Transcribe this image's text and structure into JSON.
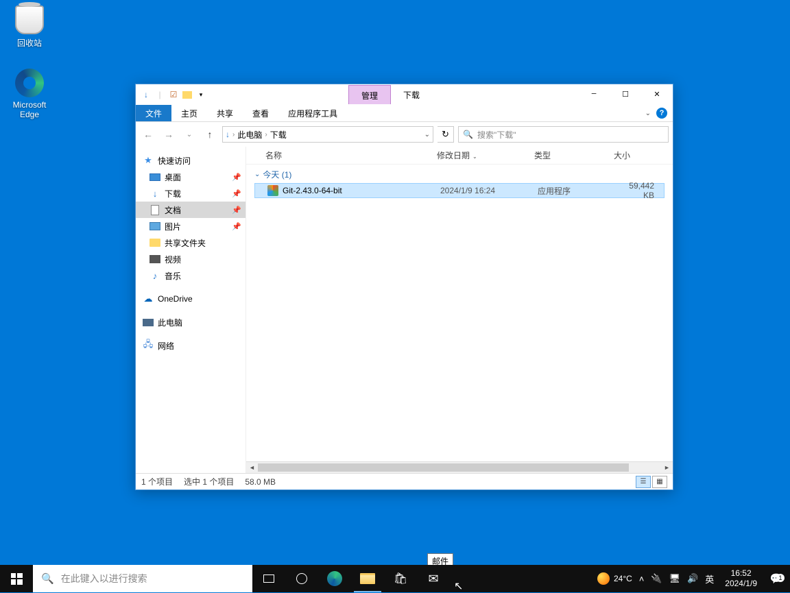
{
  "desktop": {
    "recycle_bin": "回收站",
    "edge": "Microsoft\nEdge"
  },
  "window": {
    "title_manage": "管理",
    "title_location": "下载",
    "ribbon": {
      "file": "文件",
      "home": "主页",
      "share": "共享",
      "view": "查看",
      "app_tools": "应用程序工具"
    },
    "address": {
      "root": "此电脑",
      "current": "下载"
    },
    "search_placeholder": "搜索\"下载\"",
    "nav": {
      "quick_access": "快速访问",
      "desktop": "桌面",
      "downloads": "下载",
      "documents": "文档",
      "pictures": "图片",
      "shared": "共享文件夹",
      "videos": "视频",
      "music": "音乐",
      "onedrive": "OneDrive",
      "this_pc": "此电脑",
      "network": "网络"
    },
    "columns": {
      "name": "名称",
      "date": "修改日期",
      "type": "类型",
      "size": "大小"
    },
    "group_today": "今天 (1)",
    "files": [
      {
        "name": "Git-2.43.0-64-bit",
        "date": "2024/1/9 16:24",
        "type": "应用程序",
        "size": "59,442 KB"
      }
    ],
    "status": {
      "items": "1 个项目",
      "selected": "选中 1 个项目",
      "size": "58.0 MB"
    }
  },
  "tooltip": "邮件",
  "taskbar": {
    "search_placeholder": "在此键入以进行搜索",
    "weather_temp": "24°C",
    "ime": "英",
    "time": "16:52",
    "date": "2024/1/9",
    "notif_count": "1"
  }
}
